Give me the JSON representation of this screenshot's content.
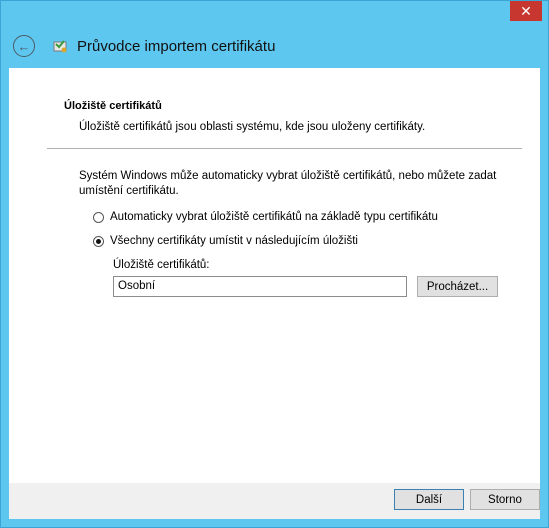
{
  "window": {
    "close_glyph": "✕",
    "title": "Průvodce importem certifikátu",
    "back_glyph": "←"
  },
  "section": {
    "title": "Úložiště certifikátů",
    "description": "Úložiště certifikátů jsou oblasti systému, kde jsou uloženy certifikáty."
  },
  "intro": "Systém Windows může automaticky vybrat úložiště certifikátů, nebo můžete zadat umístění certifikátu.",
  "options": {
    "auto_label": "Automaticky vybrat úložiště certifikátů na základě typu certifikátu",
    "manual_label": "Všechny certifikáty umístit v následujícím úložišti",
    "selected": "manual"
  },
  "store": {
    "label": "Úložiště certifikátů:",
    "value": "Osobní",
    "browse_label": "Procházet..."
  },
  "footer": {
    "next_label": "Další",
    "cancel_label": "Storno"
  }
}
